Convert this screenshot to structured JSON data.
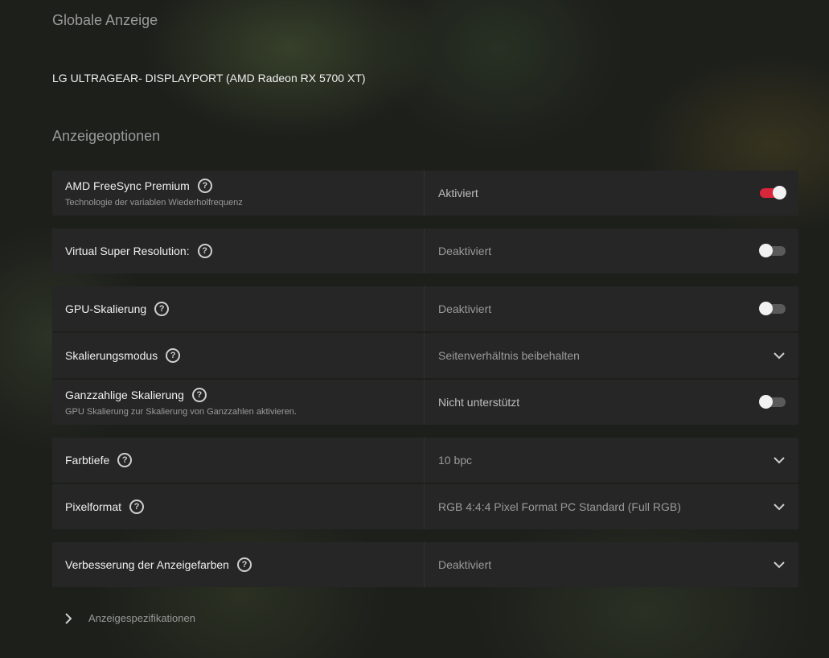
{
  "header": {
    "global_title": "Globale Anzeige",
    "display_name": "LG ULTRAGEAR- DISPLAYPORT (AMD Radeon RX 5700 XT)"
  },
  "options_title": "Anzeigeoptionen",
  "rows": {
    "freesync": {
      "label": "AMD FreeSync Premium",
      "sub": "Technologie der variablen Wiederholfrequenz",
      "value": "Aktiviert",
      "state": "on"
    },
    "vsr": {
      "label": "Virtual Super Resolution:",
      "value": "Deaktiviert",
      "state": "off"
    },
    "gpu_scaling": {
      "label": "GPU-Skalierung",
      "value": "Deaktiviert",
      "state": "off"
    },
    "scaling_mode": {
      "label": "Skalierungsmodus",
      "value": "Seitenverhältnis beibehalten"
    },
    "integer_scaling": {
      "label": "Ganzzahlige Skalierung",
      "sub": "GPU Skalierung zur Skalierung von Ganzzahlen aktivieren.",
      "value": "Nicht unterstützt",
      "state": "off"
    },
    "color_depth": {
      "label": "Farbtiefe",
      "value": "10 bpc"
    },
    "pixel_format": {
      "label": "Pixelformat",
      "value": "RGB 4:4:4 Pixel Format PC Standard (Full RGB)"
    },
    "color_enhance": {
      "label": "Verbesserung der Anzeigefarben",
      "value": "Deaktiviert"
    }
  },
  "help_glyph": "?",
  "footer": {
    "label": "Anzeigespezifikationen"
  },
  "colors": {
    "accent": "#d8263a",
    "panel": "#262626"
  }
}
